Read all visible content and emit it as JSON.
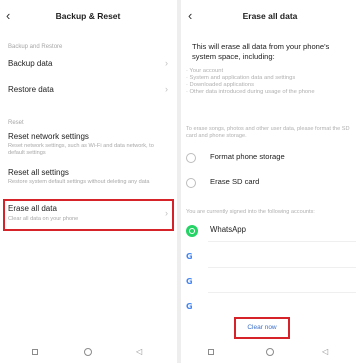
{
  "left": {
    "title": "Backup & Reset",
    "back_glyph": "‹",
    "section_backup": "Backup and Restore",
    "backup_data": "Backup data",
    "restore_data": "Restore data",
    "section_reset": "Reset",
    "reset_network": "Reset network settings",
    "reset_network_desc": "Reset network settings, such as Wi-Fi and data network, to default settings",
    "reset_all": "Reset all settings",
    "reset_all_desc": "Restore system default settings without deleting any data",
    "erase_all": "Erase all data",
    "erase_all_desc": "Clear all data on your phone",
    "chevron": "›"
  },
  "right": {
    "title": "Erase all data",
    "back_glyph": "‹",
    "warning": "This will erase all data from your phone's system space, including:",
    "bullet_1": "· Your account",
    "bullet_2": "· System and application data and settings",
    "bullet_3": "· Downloaded applications",
    "bullet_4": "· Other data introduced during usage of the phone",
    "format_note": "To erase songs, photos and other user data, please format the SD card and phone storage.",
    "format_phone": "Format phone storage",
    "erase_sd": "Erase SD card",
    "accounts_note": "You are currently signed into the following accounts:",
    "whatsapp": "WhatsApp",
    "google_glyph": "G",
    "clear_now": "Clear now"
  },
  "icons": {
    "back": "back-arrow-icon",
    "chevron": "chevron-right-icon",
    "whatsapp": "whatsapp-icon",
    "google": "google-icon",
    "nav_recents": "square-icon",
    "nav_home": "circle-icon",
    "nav_back": "triangle-back-icon"
  },
  "nav": {
    "back_glyph": "◁"
  },
  "colors": {
    "highlight": "#d6232a",
    "link": "#3b6ec7",
    "whatsapp": "#25d366",
    "google": "#4285f4"
  }
}
